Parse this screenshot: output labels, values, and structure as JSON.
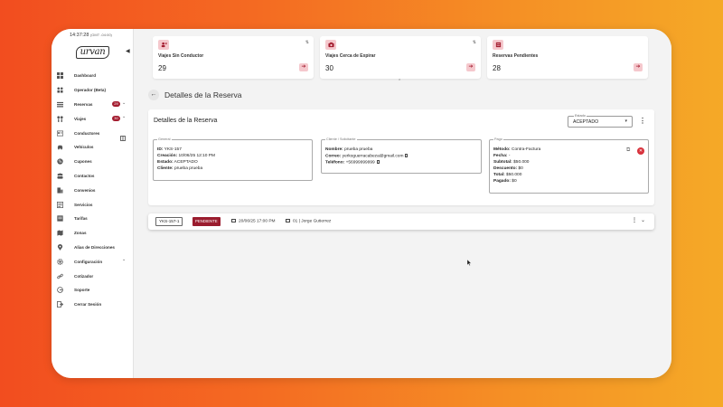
{
  "status_bar": {
    "time": "14:37:28",
    "timezone": "(GMT -04:00)"
  },
  "brand": {
    "logo_text": "urvan"
  },
  "sidebar": {
    "items": [
      {
        "label": "Dashboard",
        "icon": "dashboard-icon"
      },
      {
        "label": "Operador (Beta)",
        "icon": "operator-icon"
      },
      {
        "label": "Reservas",
        "icon": "reservations-icon",
        "badge": "29",
        "chevron": true
      },
      {
        "label": "Viajes",
        "icon": "trips-icon",
        "badge": "30",
        "chevron": true
      },
      {
        "label": "Conductores",
        "icon": "id-card-icon",
        "extra_icon": "book-icon"
      },
      {
        "label": "Vehículos",
        "icon": "car-icon"
      },
      {
        "label": "Cupones",
        "icon": "coupon-icon"
      },
      {
        "label": "Contactos",
        "icon": "contacts-icon"
      },
      {
        "label": "Convenios",
        "icon": "agreements-icon"
      },
      {
        "label": "Servicios",
        "icon": "services-icon"
      },
      {
        "label": "Tarifas",
        "icon": "rates-icon"
      },
      {
        "label": "Zonas",
        "icon": "map-icon"
      },
      {
        "label": "Alias de Direcciones",
        "icon": "location-pin-icon"
      },
      {
        "label": "Configuración",
        "icon": "gear-icon",
        "chevron": true
      },
      {
        "label": "Cotizador",
        "icon": "link-icon"
      },
      {
        "label": "Soporte",
        "icon": "support-icon"
      },
      {
        "label": "Cerrar Sesión",
        "icon": "logout-icon"
      }
    ]
  },
  "stats": [
    {
      "title": "Viajes Sin Conductor",
      "value": "29",
      "icon": "user-x-icon"
    },
    {
      "title": "Viajes Cerca de Expirar",
      "value": "30",
      "icon": "camera-icon"
    },
    {
      "title": "Reservas Pendientes",
      "value": "28",
      "icon": "list-icon"
    }
  ],
  "page": {
    "title": "Detalles de la Reserva"
  },
  "detail": {
    "title": "Detalles de la Reserva",
    "estado_label": "Estado",
    "estado_value": "ACEPTADO",
    "general": {
      "legend": "General",
      "id_label": "ID:",
      "id_value": "YKS-157",
      "creacion_label": "Creación:",
      "creacion_value": "10/06/25 12:10 PM",
      "estado_label": "Estado:",
      "estado_value": "ACEPTADO",
      "cliente_label": "Cliente:",
      "cliente_value": "prueba prueba"
    },
    "cliente": {
      "legend": "Cliente / Solicitante",
      "nombre_label": "Nombre:",
      "nombre_value": "prueba prueba",
      "correo_label": "Correo:",
      "correo_value": "yerkoguerracabeza@gmail.com",
      "telefono_label": "Teléfono:",
      "telefono_value": "+56999999999"
    },
    "pago": {
      "legend": "Pago",
      "metodo_label": "Método:",
      "metodo_value": "Contra-Factura",
      "fecha_label": "Fecha:",
      "fecha_value": "-",
      "subtotal_label": "Subtotal:",
      "subtotal_value": "$50.000",
      "descuento_label": "Descuento:",
      "descuento_value": "$0",
      "total_label": "Total:",
      "total_value": "$50.000",
      "pagado_label": "Pagado:",
      "pagado_value": "$0"
    }
  },
  "trip": {
    "id": "YKS-157-1",
    "status": "PENDIENTE",
    "datetime": "20/06/25 17:00 PM",
    "driver": "01 | Jorge Gutierrez"
  },
  "colors": {
    "accent": "#a31c2f",
    "badge_bg": "#f5c8cd",
    "fab": "#243a8c",
    "cancel": "#d8323c"
  }
}
